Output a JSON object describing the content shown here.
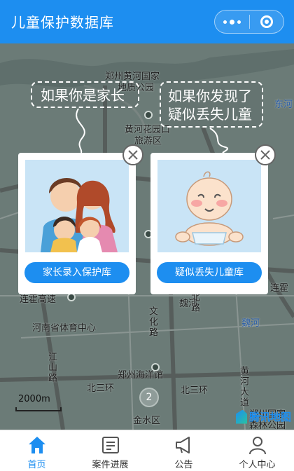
{
  "header": {
    "title": "儿童保护数据库"
  },
  "map": {
    "labels": [
      "郑州黄河国家",
      "地质公园",
      "黄河花园口",
      "旅游区",
      "连霍高速",
      "河南省体育中心",
      "江山路",
      "郑州海洋馆",
      "北三环",
      "北三环",
      "金水区",
      "魏河",
      "魏河",
      "北路",
      "郑州国家",
      "森林公园",
      "文化路",
      "连霍",
      "东河",
      "黄河大道"
    ],
    "cluster_count": "2",
    "scale": "2000m",
    "provider": "腾讯地图"
  },
  "bubbles": {
    "parent": "如果你是家长",
    "found_line1": "如果你发现了",
    "found_line2": "疑似丢失儿童"
  },
  "cards": {
    "parent_button": "家长录入保护库",
    "child_button": "疑似丢失儿童库"
  },
  "tabs": [
    {
      "label": "首页",
      "icon": "home-icon"
    },
    {
      "label": "案件进展",
      "icon": "case-progress-icon"
    },
    {
      "label": "公告",
      "icon": "megaphone-icon"
    },
    {
      "label": "个人中心",
      "icon": "person-icon"
    }
  ],
  "colors": {
    "brand": "#1d8ef0",
    "map_bg": "#6b7b77"
  }
}
